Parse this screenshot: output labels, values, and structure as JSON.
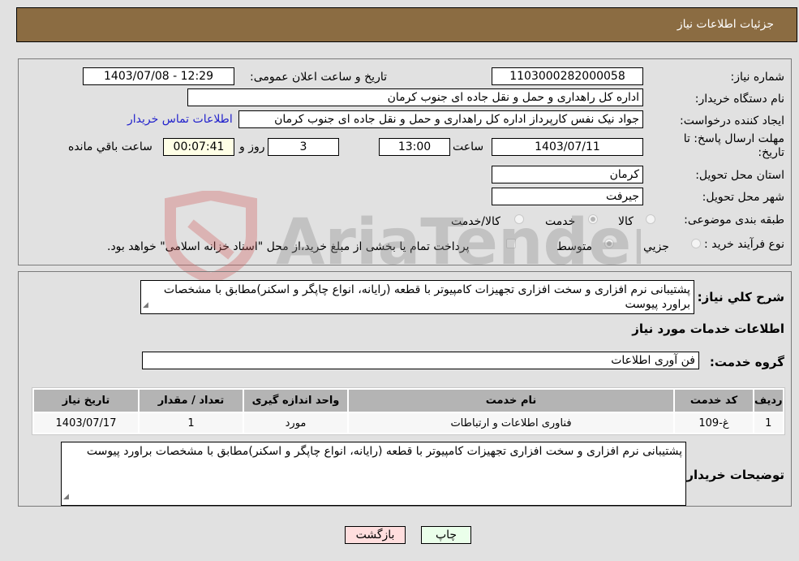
{
  "header": {
    "title": "جزئیات اطلاعات نیاز"
  },
  "form": {
    "need_number": {
      "label": "شماره نیاز:",
      "value": "1103000282000058"
    },
    "announce_datetime": {
      "label": "تاریخ و ساعت اعلان عمومی:",
      "value": "1403/07/08 - 12:29"
    },
    "buyer_org": {
      "label": "نام دستگاه خریدار:",
      "value": "اداره کل راهداری و حمل و نقل جاده ای جنوب کرمان"
    },
    "requester": {
      "label": "ایجاد کننده درخواست:",
      "value": "جواد  نیک نفس کارپرداز اداره کل راهداری و حمل و نقل جاده ای جنوب کرمان"
    },
    "buyer_contact_link": "اطلاعات تماس خریدار",
    "deadline": {
      "label": "مهلت ارسال پاسخ: تا تاریخ:",
      "date": "1403/07/11",
      "time_label": "ساعت",
      "time": "13:00",
      "days": "3",
      "days_label": "روز و",
      "remaining": "00:07:41",
      "remaining_label": "ساعت باقي مانده"
    },
    "province": {
      "label": "استان محل تحویل:",
      "value": "کرمان"
    },
    "city": {
      "label": "شهر محل تحویل:",
      "value": "جیرفت"
    },
    "category": {
      "label": "طبقه بندی موضوعی:",
      "options": [
        {
          "label": "کالا",
          "selected": false
        },
        {
          "label": "خدمت",
          "selected": true
        },
        {
          "label": "کالا/خدمت",
          "selected": false
        }
      ]
    },
    "purchase_type": {
      "label": "نوع فرآیند خرید :",
      "options": [
        {
          "label": "جزيي",
          "selected": false
        },
        {
          "label": "متوسط",
          "selected": true
        }
      ],
      "treasury_note": "پرداخت تمام یا بخشی از مبلغ خرید،از محل \"اسناد خزانه اسلامی\" خواهد بود.",
      "treasury_checked": false
    }
  },
  "details": {
    "description_label": "شرح کلي نیاز:",
    "description": "پشتیبانی نرم افزاری و سخت افزاری تجهیزات کامپیوتر با قطعه (رایانه، انواع چاپگر و اسکنر)مطابق با مشخصات براورد پیوست",
    "services_heading": "اطلاعات خدمات مورد نیاز",
    "service_group_label": "گروه خدمت:",
    "service_group": "فن آوری اطلاعات",
    "table": {
      "headers": [
        "ردیف",
        "کد خدمت",
        "نام خدمت",
        "واحد اندازه گیری",
        "تعداد / مقدار",
        "تاریخ نیاز"
      ],
      "rows": [
        [
          "1",
          "غ-109",
          "فناوری اطلاعات و ارتباطات",
          "مورد",
          "1",
          "1403/07/17"
        ]
      ]
    },
    "buyer_notes_label": "توضیحات خریدار:",
    "buyer_notes": "پشتیبانی نرم افزاری و سخت افزاری تجهیزات کامپیوتر با قطعه (رایانه، انواع چاپگر و اسکنر)مطابق با مشخصات براورد پیوست"
  },
  "buttons": {
    "print": "چاپ",
    "back": "بازگشت"
  },
  "watermark": {
    "text": "AriaTender.neT"
  },
  "colors": {
    "header_bg": "#8b6c42",
    "print_bg": "#eaffea",
    "back_bg": "#ffdede",
    "link": "#2222cc"
  }
}
